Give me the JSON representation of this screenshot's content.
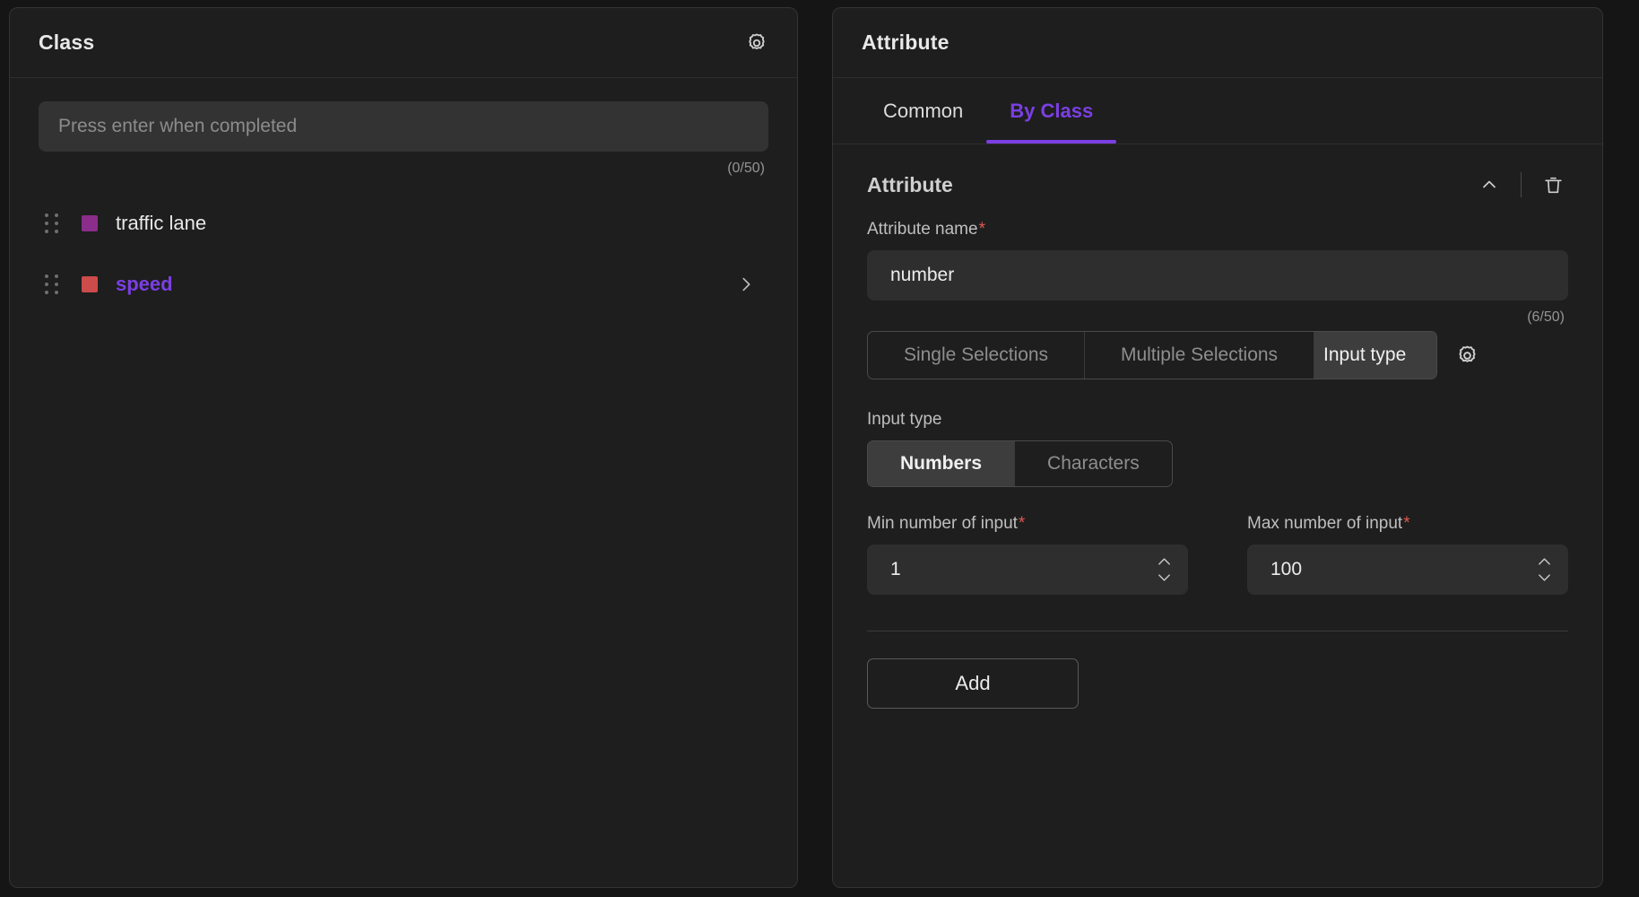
{
  "theme": {
    "accent": "#7b3fe4",
    "required_marker": "#e0584f",
    "panel_bg": "#1e1e1e",
    "page_bg": "#151515",
    "input_bg": "#2e2e2e"
  },
  "left_panel": {
    "title": "Class",
    "settings_icon": "gear-icon",
    "input": {
      "value": "",
      "placeholder": "Press enter when completed"
    },
    "counter": "(0/50)",
    "items": [
      {
        "label": "traffic lane",
        "color": "#8b2d8b",
        "selected": false,
        "has_chevron": false,
        "drag_icon": "drag-handle-icon"
      },
      {
        "label": "speed",
        "color": "#cc4b4b",
        "selected": true,
        "has_chevron": true,
        "chevron_icon": "chevron-right-icon",
        "drag_icon": "drag-handle-icon"
      }
    ]
  },
  "right_panel": {
    "title": "Attribute",
    "tabs": [
      {
        "label": "Common",
        "active": false
      },
      {
        "label": "By Class",
        "active": true
      }
    ],
    "section": {
      "title": "Attribute",
      "collapse_icon": "chevron-up-icon",
      "delete_icon": "trash-icon",
      "attribute_name": {
        "label": "Attribute name",
        "required": "*",
        "value": "number",
        "counter": "(6/50)"
      },
      "selection_mode": {
        "options": [
          "Single Selections",
          "Multiple Selections",
          "Input type"
        ],
        "selected": "Input type",
        "settings_icon": "gear-icon"
      },
      "input_type": {
        "label": "Input type",
        "options": [
          "Numbers",
          "Characters"
        ],
        "selected": "Numbers"
      },
      "min_input": {
        "label": "Min number of input",
        "required": "*",
        "value": "1",
        "up_icon": "chevron-up-icon",
        "down_icon": "chevron-down-icon"
      },
      "max_input": {
        "label": "Max number of input",
        "required": "*",
        "value": "100",
        "up_icon": "chevron-up-icon",
        "down_icon": "chevron-down-icon"
      },
      "add_button": "Add"
    }
  }
}
